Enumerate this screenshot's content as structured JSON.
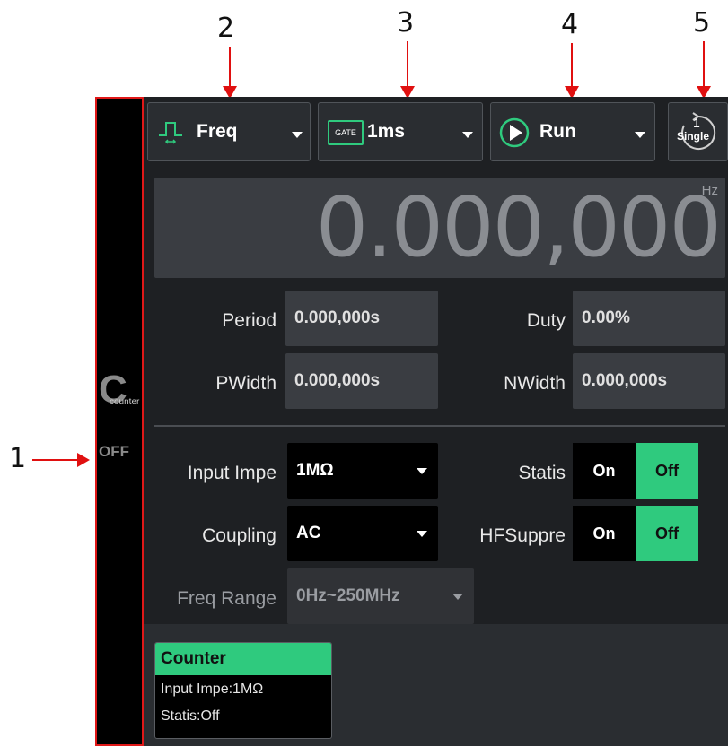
{
  "annotations": {
    "sidebar_num": "1",
    "func_num": "2",
    "gate_num": "3",
    "run_num": "4",
    "single_num": "5"
  },
  "sidebar": {
    "letter": "C",
    "module": "counter",
    "state": "OFF"
  },
  "toolbar": {
    "function": {
      "label": "Freq",
      "icon": "pulse-icon"
    },
    "gate": {
      "badge": "GATE",
      "label": "1ms"
    },
    "run": {
      "label": "Run",
      "icon": "play-icon"
    },
    "single": {
      "count": "1",
      "label": "Single",
      "icon": "single-icon"
    }
  },
  "measurement": {
    "unit": "Hz",
    "value": "0.000,000"
  },
  "readouts": {
    "period": {
      "label": "Period",
      "value": "0.000,000s"
    },
    "duty": {
      "label": "Duty",
      "value": "0.00%"
    },
    "pwidth": {
      "label": "PWidth",
      "value": "0.000,000s"
    },
    "nwidth": {
      "label": "NWidth",
      "value": "0.000,000s"
    }
  },
  "settings": {
    "input_impedance": {
      "label": "Input Impe",
      "value": "1MΩ"
    },
    "coupling": {
      "label": "Coupling",
      "value": "AC"
    },
    "freq_range": {
      "label": "Freq Range",
      "value": "0Hz~250MHz"
    },
    "statis": {
      "label": "Statis",
      "on": "On",
      "off": "Off",
      "selected": "Off"
    },
    "hfsuppress": {
      "label": "HFSuppre",
      "on": "On",
      "off": "Off",
      "selected": "Off"
    }
  },
  "status_card": {
    "title": "Counter",
    "line1": "Input Impe:1MΩ",
    "line2": "Statis:Off"
  },
  "colors": {
    "accent": "#2fca7e",
    "callout": "#e01010",
    "panel": "#1e2023",
    "field": "#3a3d42"
  }
}
